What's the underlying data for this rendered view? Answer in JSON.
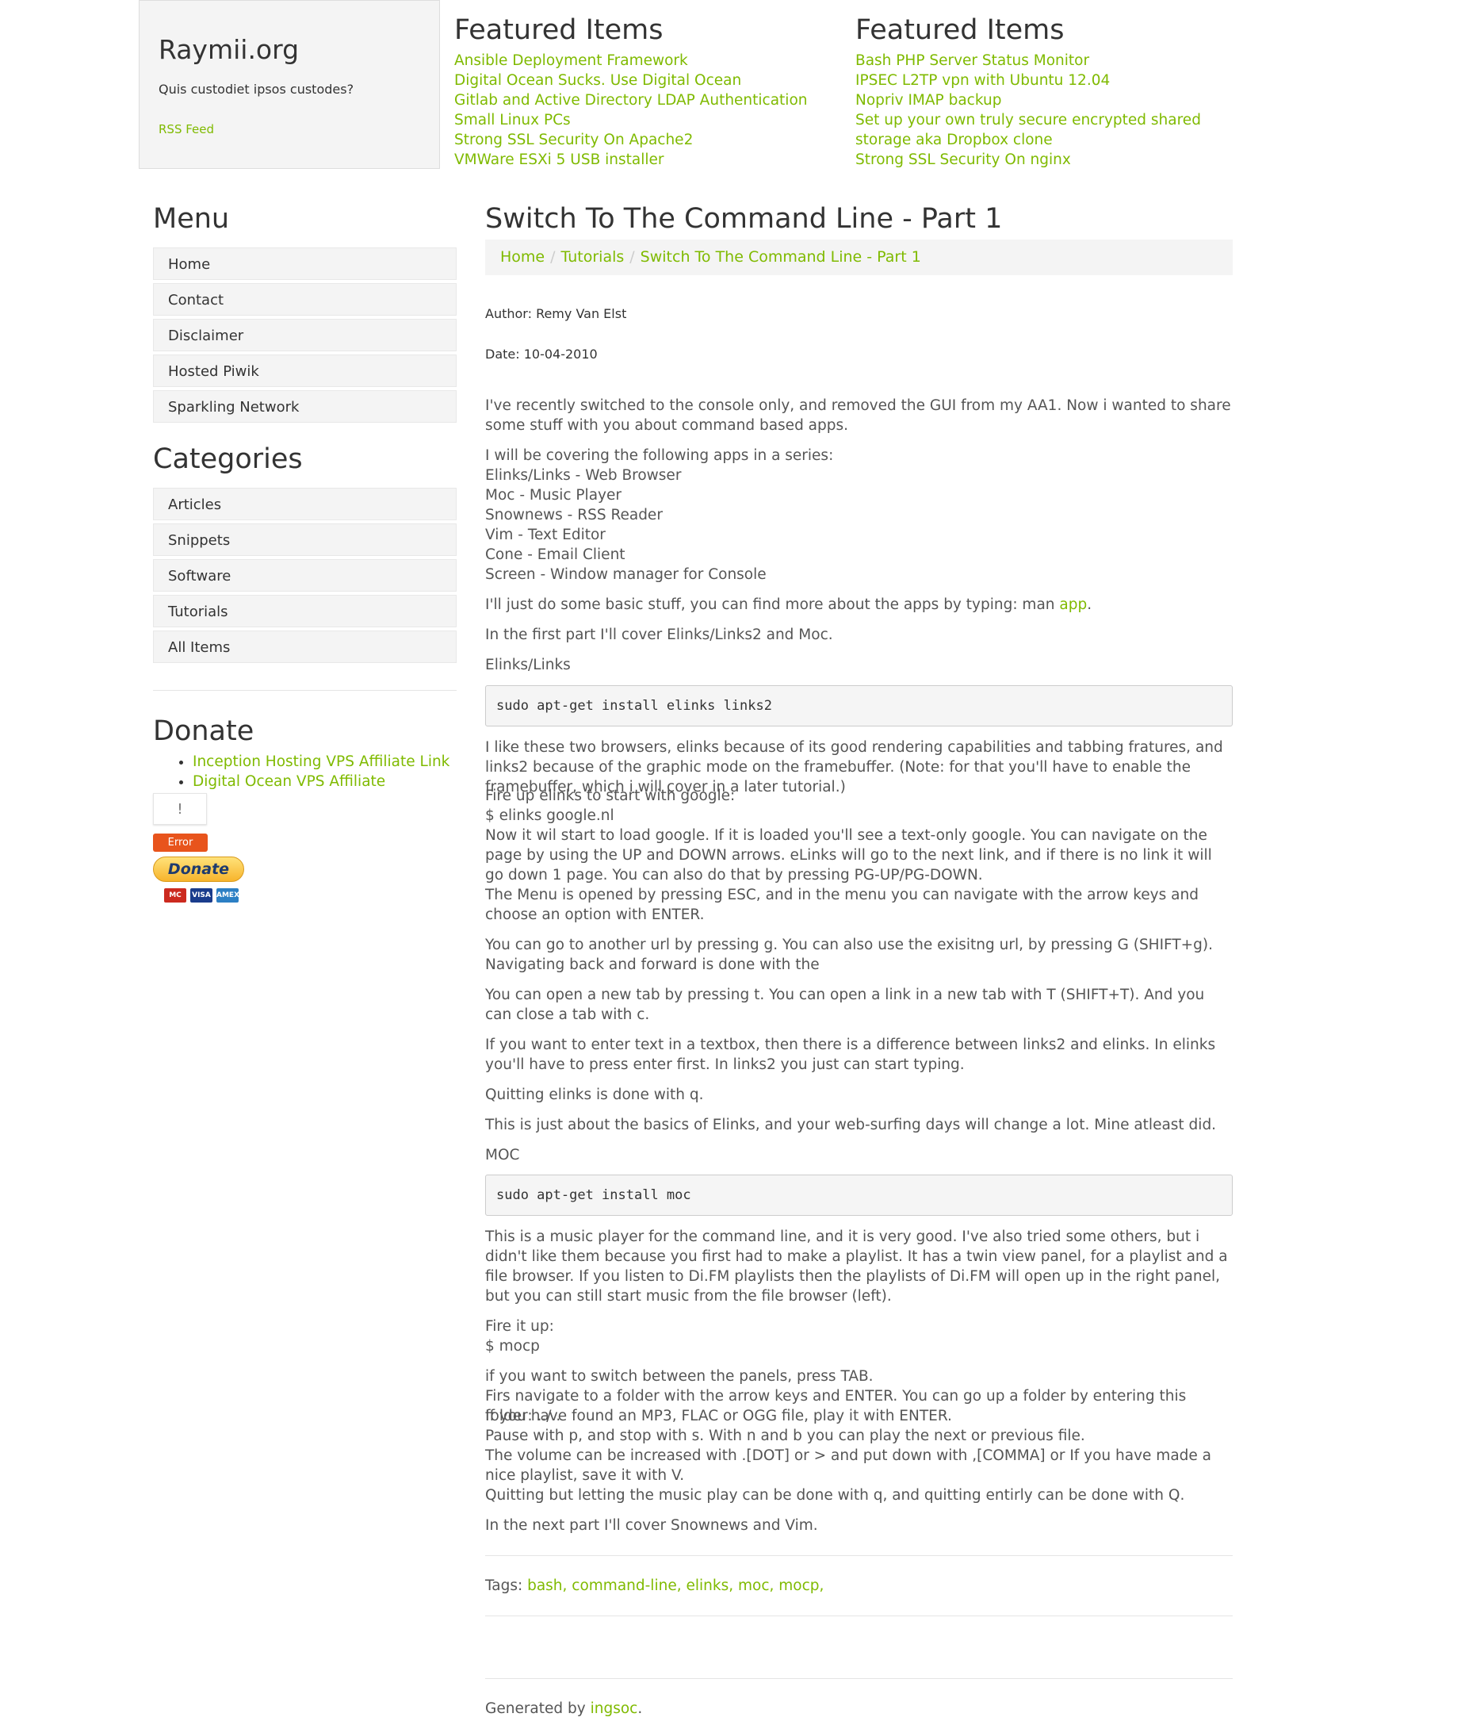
{
  "header": {
    "site_title": "Raymii.org",
    "tagline": "Quis custodiet ipsos custodes?",
    "rss": "RSS Feed",
    "featured_left": {
      "title": "Featured Items",
      "items": [
        "Ansible Deployment Framework",
        "Digital Ocean Sucks. Use Digital Ocean",
        "Gitlab and Active Directory LDAP Authentication",
        "Small Linux PCs",
        "Strong SSL Security On Apache2",
        "VMWare ESXi 5 USB installer"
      ]
    },
    "featured_right": {
      "title": "Featured Items",
      "items": [
        "Bash PHP Server Status Monitor",
        "IPSEC L2TP vpn with Ubuntu 12.04",
        "Nopriv IMAP backup",
        "Set up your own truly secure encrypted shared",
        "storage aka Dropbox clone",
        "Strong SSL Security On nginx"
      ]
    }
  },
  "sidebar": {
    "menu_title": "Menu",
    "menu": [
      "Home",
      "Contact",
      "Disclaimer",
      "Hosted Piwik",
      "Sparkling Network"
    ],
    "categories_title": "Categories",
    "categories": [
      "Articles",
      "Snippets",
      "Software",
      "Tutorials",
      "All Items"
    ],
    "donate_title": "Donate",
    "donate_links": [
      "Inception Hosting VPS Affiliate Link",
      "Digital Ocean VPS Affiliate"
    ],
    "error_icon": "!",
    "error_label": "Error",
    "donate_button": "Donate",
    "cards": [
      "MC",
      "VISA",
      "AMEX"
    ]
  },
  "article": {
    "title": "Switch To The Command Line - Part 1",
    "breadcrumb": [
      "Home",
      "Tutorials",
      "Switch To The Command Line - Part 1"
    ],
    "author": "Author: Remy Van Elst",
    "date": "Date: 10-04-2010",
    "p1": "I've recently switched to the console only, and removed the GUI from my AA1. Now i wanted to share some stuff with you about command based apps.",
    "series_intro": "I will be covering the following apps in a series:",
    "series": [
      "Elinks/Links - Web Browser",
      "Moc - Music Player",
      "Snownews - RSS Reader",
      "Vim - Text Editor",
      "Cone - Email Client",
      "Screen - Window manager for Console"
    ],
    "man_pre": "I'll just do some basic stuff, you can find more about the apps by typing: man ",
    "man_link": "app",
    "man_post": ".",
    "first_part": "In the first part I'll cover Elinks/Links2 and Moc.",
    "h_elinks": "Elinks/Links",
    "code1": "sudo apt-get install elinks links2",
    "p_browsers": "I like these two browsers, elinks because of its good rendering capabilities and tabbing fratures, and links2 because of the graphic mode on the framebuffer. (Note: for that you'll have to enable the framebuffer, which i will cover in a later tutorial.)",
    "fire_elinks": "Fire up elinks to start with google:",
    "cmd_elinks": "$ elinks google.nl",
    "p_load": "Now it wil start to load google. If it is loaded you'll see a text-only google. You can navigate on the page by using the UP and DOWN arrows. eLinks will go to the next link, and if there is no link it will go down 1 page. You can also do that by pressing PG-UP/PG-DOWN.",
    "p_menu": "The Menu is opened by pressing ESC, and in the menu you can navigate with the arrow keys and choose an option with ENTER.",
    "p_url": "You can go to another url by pressing g. You can also use the exisitng url, by pressing G (SHIFT+g). Navigating back and forward is done with the",
    "p_tab": "You can open a new tab by pressing t. You can open a link in a new tab with T (SHIFT+T). And you can close a tab with c.",
    "p_textbox": "If you want to enter text in a textbox, then there is a difference between links2 and elinks. In elinks you'll have to press enter first. In links2 you just can start typing.",
    "p_quit": "Quitting elinks is done with q.",
    "p_basics": "This is just about the basics of Elinks, and your web-surfing days will change a lot. Mine atleast did.",
    "h_moc": "MOC",
    "code2": "sudo apt-get install moc",
    "p_moc": "This is a music player for the command line, and it is very good. I've also tried some others, but i didn't like them because you first had to make a playlist. It has a twin view panel, for a playlist and a file browser. If you listen to Di.FM playlists then the playlists of Di.FM will open up in the right panel, but you can still start music from the file browser (left).",
    "fire_moc": "Fire it up:",
    "cmd_moc": "$ mocp",
    "moc_lines": [
      "if you want to switch between the panels, press TAB.",
      "Firs navigate to a folder with the arrow keys and ENTER. You can go up a folder by entering this folder: ../ .",
      "If you have found an MP3, FLAC or OGG file, play it with ENTER.",
      "Pause with p, and stop with s. With n and b you can play the next or previous file.",
      "The volume can be increased with .[DOT] or > and put down with ,[COMMA] or If you have made a nice playlist, save it with V.",
      "Quitting but letting the music play can be done with q, and quitting entirly can be done with Q."
    ],
    "next_part": "In the next part I'll cover Snownews and Vim.",
    "tags_label": "Tags: ",
    "tags": [
      "bash,",
      "command-line,",
      "elinks,",
      "moc,",
      "mocp,"
    ]
  },
  "footer": {
    "generated_pre": "Generated by ",
    "generated_link": "ingsoc",
    "generated_post": "."
  }
}
